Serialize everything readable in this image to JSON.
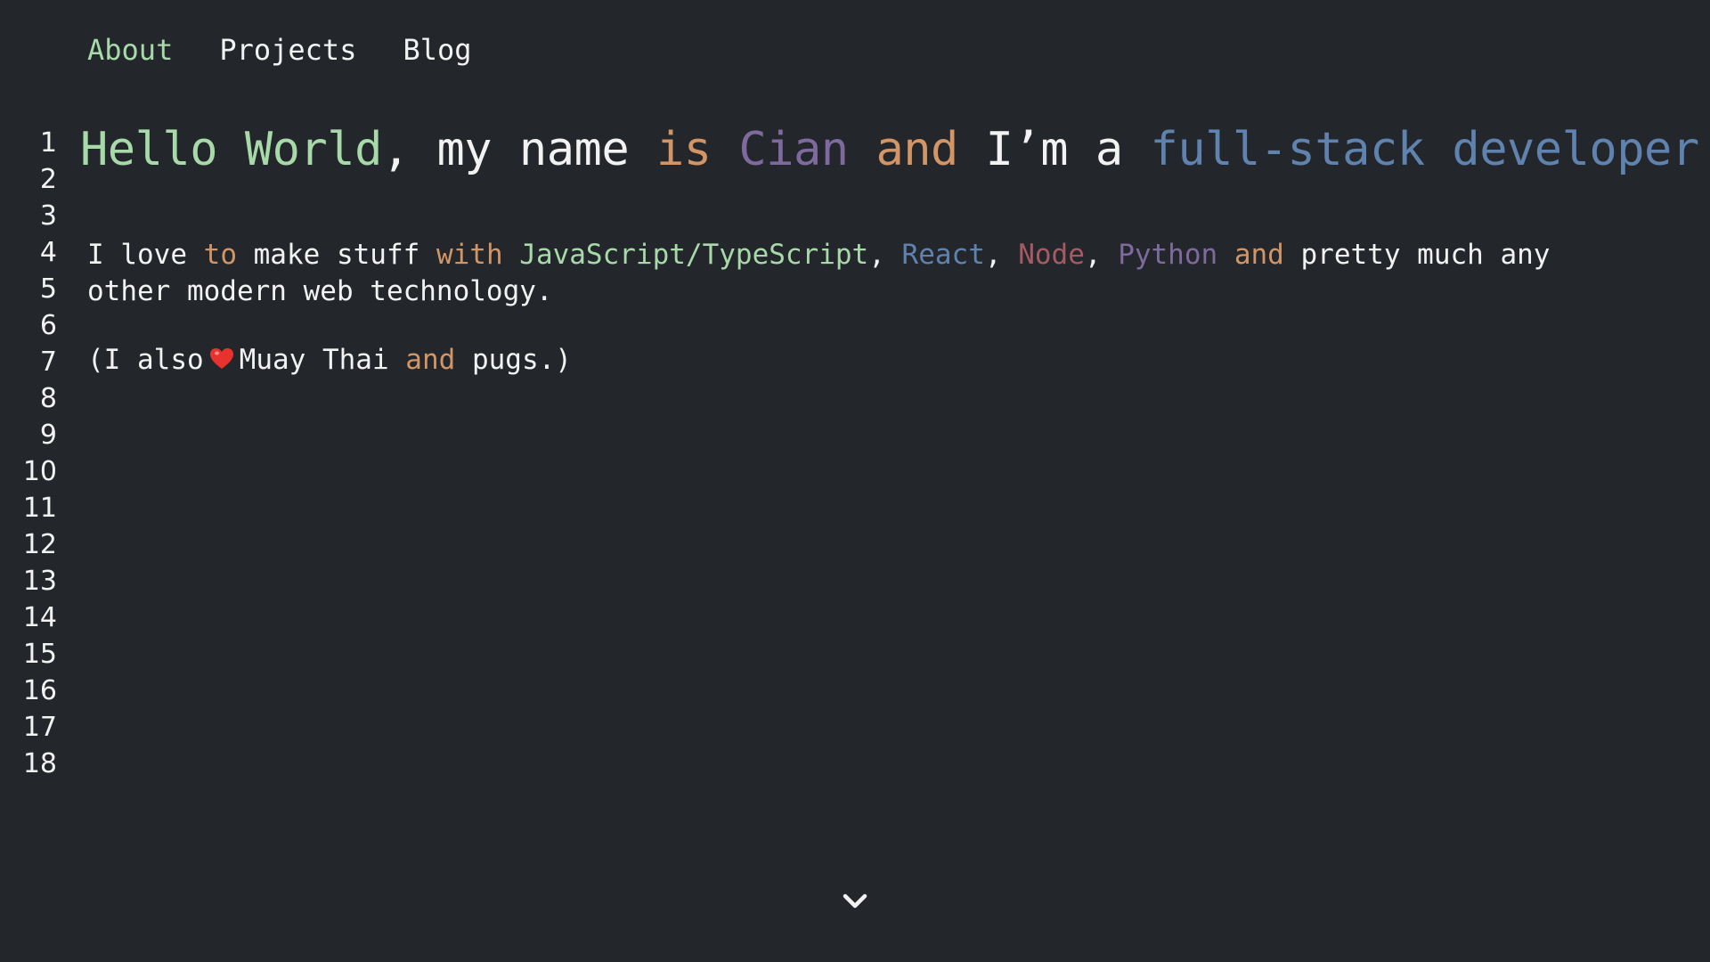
{
  "nav": {
    "items": [
      "About",
      "Projects",
      "Blog"
    ],
    "active": "About"
  },
  "line_numbers": [
    "1",
    "2",
    "3",
    "4",
    "5",
    "6",
    "7",
    "8",
    "9",
    "10",
    "11",
    "12",
    "13",
    "14",
    "15",
    "16",
    "17",
    "18"
  ],
  "headline": {
    "w1": "Hello World",
    "w2": ", my name ",
    "w3": "is",
    "w4": " ",
    "w5": "Cian",
    "w6": " ",
    "w7": "and",
    "w8": " I’m a ",
    "w9": "full-stack developer."
  },
  "paragraph1": {
    "t1": "I love ",
    "t2": "to",
    "t3": " make stuff ",
    "t4": "with",
    "t5": " ",
    "t6": "JavaScript/TypeScript",
    "t7": ", ",
    "t8": "React",
    "t9": ", ",
    "t10": "Node",
    "t11": ", ",
    "t12": "Python",
    "t13": " ",
    "t14": "and",
    "t15": " pretty much any",
    "line2": "other modern web technology."
  },
  "paragraph2": {
    "t1": "(I also",
    "t2": "Muay Thai ",
    "t3": "and",
    "t4": " pugs.)"
  },
  "icons": {
    "heart": "heart-icon",
    "scroll": "chevron-down-icon"
  },
  "colors": {
    "background": "#23272c",
    "text": "#f2f2f2",
    "green": "#a8d9a9",
    "orange": "#d29566",
    "purple": "#7f6a9e",
    "blue": "#5f82ae",
    "red": "#a65a63"
  }
}
